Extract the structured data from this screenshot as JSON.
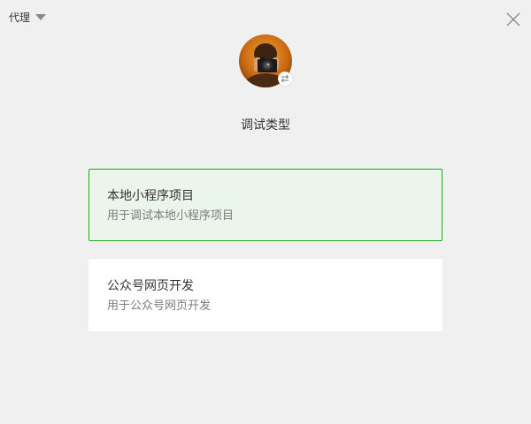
{
  "header": {
    "proxy_label": "代理"
  },
  "title": "调试类型",
  "options": [
    {
      "title": "本地小程序项目",
      "description": "用于调试本地小程序项目",
      "selected": true
    },
    {
      "title": "公众号网页开发",
      "description": "用于公众号网页开发",
      "selected": false
    }
  ],
  "icons": {
    "proxy_dropdown": "caret-down-icon",
    "close": "close-icon",
    "switch_account": "switch-arrows-icon"
  },
  "colors": {
    "background": "#f0f0f0",
    "accent": "#1aad19",
    "selected_card_bg": "#ebf5eb",
    "card_bg": "#ffffff",
    "primary_text": "#353535",
    "secondary_text": "#7d7d7d"
  }
}
